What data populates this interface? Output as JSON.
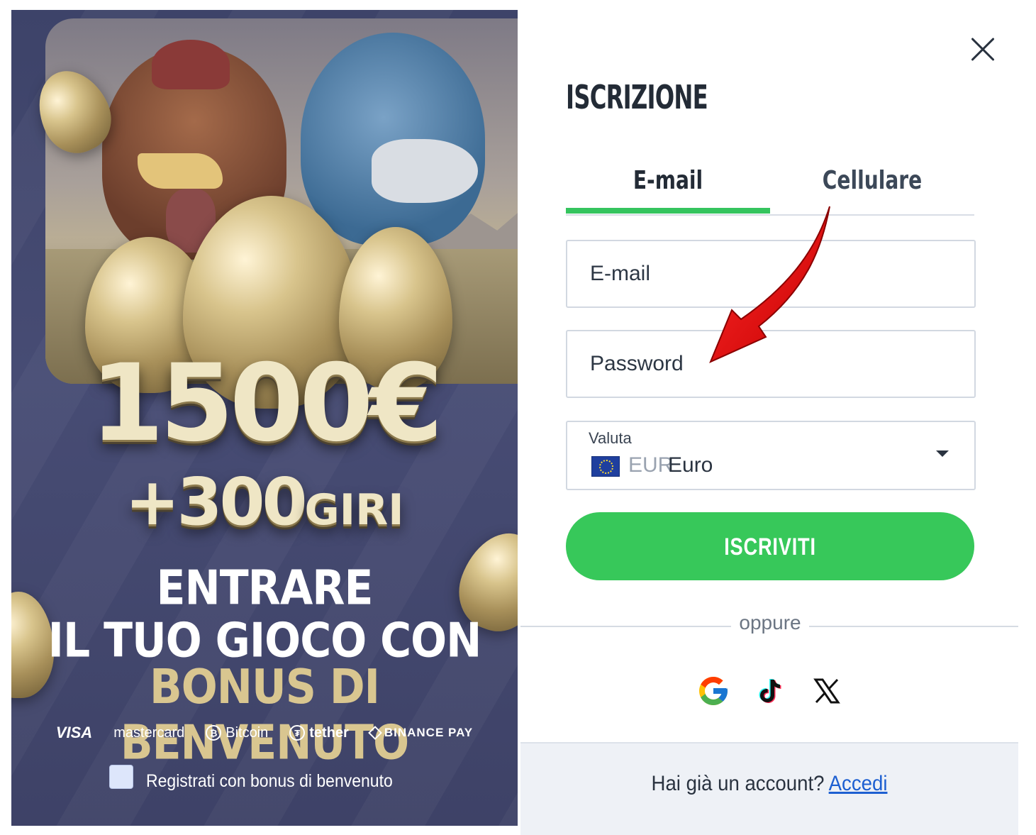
{
  "promo": {
    "amount": "1500€",
    "spins_number": "+300",
    "spins_word": "GIRI",
    "line1": "ENTRARE",
    "line2": "IL TUO GIOCO CON",
    "line3": "BONUS DI BENVENUTO",
    "payments": [
      "VISA",
      "mastercard",
      "Bitcoin",
      "tether",
      "BINANCE PAY"
    ],
    "bonus_checkbox_label": "Registrati con bonus di benvenuto",
    "bonus_checked": false
  },
  "form": {
    "title": "ISCRIZIONE",
    "tabs": [
      {
        "label": "E-mail",
        "active": true
      },
      {
        "label": "Cellulare",
        "active": false
      }
    ],
    "email_placeholder": "E-mail",
    "password_placeholder": "Password",
    "currency": {
      "label": "Valuta",
      "code": "EUR",
      "name": "Euro"
    },
    "submit_label": "ISCRIVITI",
    "or_text": "oppure",
    "social": [
      "google-icon",
      "tiktok-icon",
      "x-icon"
    ],
    "footer_question": "Hai già un account?",
    "footer_link": "Accedi"
  },
  "colors": {
    "accent_green": "#37c85a",
    "link_blue": "#1d5fd1",
    "annotation_red": "#e00000"
  }
}
